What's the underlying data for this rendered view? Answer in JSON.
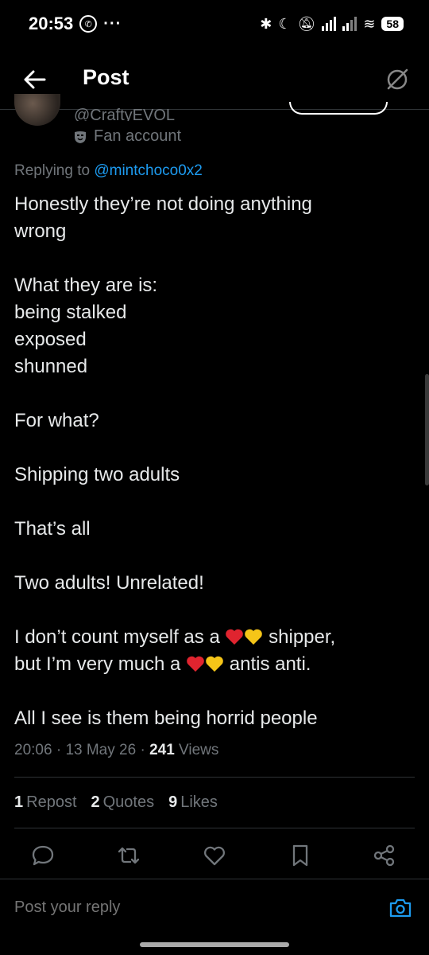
{
  "status_bar": {
    "time": "20:53",
    "battery": "58"
  },
  "header": {
    "title": "Post"
  },
  "author": {
    "handle": "@CraftyEVOL",
    "label": "Fan account"
  },
  "tweet": {
    "replying_prefix": "Replying to ",
    "replying_to": "@mintchoco0x2",
    "lines": [
      "Honestly they’re not doing anything",
      "wrong",
      "",
      "What they are is:",
      "being stalked",
      "exposed",
      "shunned",
      "",
      "For what?",
      "",
      "Shipping two adults",
      "",
      "That’s all",
      "",
      "Two adults! Unrelated!",
      ""
    ],
    "emoji_line1_before": "I don’t count myself as a ",
    "emoji_line1_after": " shipper,",
    "emoji_line2_before": "but I’m very much a ",
    "emoji_line2_after": " antis anti.",
    "last_line": "All I see is them being horrid people",
    "time": "20:06",
    "date": "13 May 26",
    "views_count": "241",
    "views_label": "Views"
  },
  "stats": {
    "reposts_count": "1",
    "reposts_label": "Repost",
    "quotes_count": "2",
    "quotes_label": "Quotes",
    "likes_count": "9",
    "likes_label": "Likes"
  },
  "reply": {
    "placeholder": "Post your reply"
  },
  "colors": {
    "accent": "#1d9bf0",
    "muted": "#71767b",
    "text": "#e7e9ea",
    "background": "#000000",
    "heart_red": "#e0242f",
    "heart_yellow": "#f5c518"
  },
  "icons": {
    "back": "arrow-left-icon",
    "grok": "grok-icon",
    "reply": "comment-icon",
    "repost": "repost-icon",
    "like": "heart-outline-icon",
    "bookmark": "bookmark-icon",
    "share": "share-icon",
    "camera": "camera-icon",
    "label": "mask-icon"
  }
}
